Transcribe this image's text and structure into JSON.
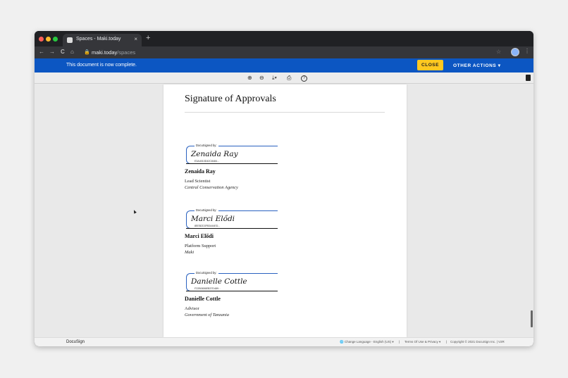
{
  "browser": {
    "tab_title": "Spaces - Maki.today",
    "tab_close": "×",
    "new_tab": "+",
    "url_host": "maki.today",
    "url_path": "/spaces",
    "nav_back": "←",
    "nav_forward": "→",
    "nav_reload": "C",
    "nav_home": "⌂",
    "lock": "🔒",
    "star": "☆",
    "menu": "⋮",
    "traffic_colors": [
      "#ff5f57",
      "#febc2e",
      "#28c840"
    ]
  },
  "banner": {
    "message": "This document is now complete.",
    "close_label": "CLOSE",
    "other_actions_label": "OTHER ACTIONS ▾"
  },
  "doc_toolbar": {
    "zoom_in": "⊕",
    "zoom_out": "⊖",
    "download": "⤓▾",
    "print": "⎙",
    "help": "?"
  },
  "document": {
    "title": "Signature of Approvals",
    "signers": [
      {
        "caption": "DocuSigned by:",
        "signature": "Zenaida Ray",
        "id": "E3A4010D42C8484...",
        "name": "Zenaida Ray",
        "role": "Lead Scientist",
        "org": "Central Conservation Agency"
      },
      {
        "caption": "DocuSigned by:",
        "signature": "Marci Elődi",
        "id": "8EEB2D3FB3444ED...",
        "name": "Marci Elődi",
        "role": "Platform Support",
        "org": "Maki"
      },
      {
        "caption": "DocuSigned by:",
        "signature": "Danielle Cottle",
        "id": "F22B0656EB37D489...",
        "name": "Danielle Cottle",
        "role": "Advisor",
        "org": "Government of Tanzania"
      }
    ]
  },
  "footer": {
    "logo": "DocuSign",
    "language": "🌐 Change Language - English (US) ▾",
    "sep1": "|",
    "terms": "Terms Of Use & Privacy ▾",
    "sep2": "|",
    "copyright": "Copyright © 2021 DocuSign Inc. | V2R"
  }
}
